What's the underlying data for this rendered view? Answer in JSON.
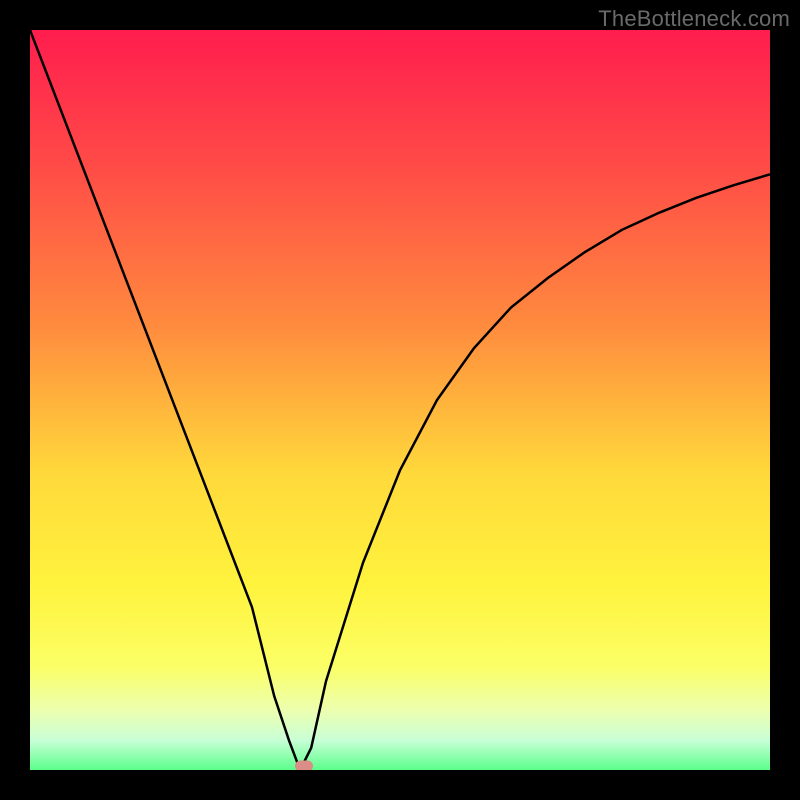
{
  "watermark": "TheBottleneck.com",
  "chart_data": {
    "type": "line",
    "title": "",
    "xlabel": "",
    "ylabel": "",
    "xlim": [
      0,
      100
    ],
    "ylim": [
      0,
      100
    ],
    "grid": false,
    "legend": false,
    "x": [
      0,
      5,
      10,
      15,
      20,
      25,
      30,
      33,
      35,
      36.5,
      38,
      40,
      45,
      50,
      55,
      60,
      65,
      70,
      75,
      80,
      85,
      90,
      95,
      100
    ],
    "values": [
      100,
      87,
      74,
      61,
      48,
      35,
      22,
      10,
      4,
      0,
      3,
      12,
      28,
      40.5,
      50,
      57,
      62.5,
      66.5,
      70,
      73,
      75.3,
      77.3,
      79,
      80.5
    ],
    "gradient_stops": [
      {
        "offset": 0,
        "color": "#ff1d4e"
      },
      {
        "offset": 0.18,
        "color": "#ff4a47"
      },
      {
        "offset": 0.4,
        "color": "#ff8b3e"
      },
      {
        "offset": 0.6,
        "color": "#ffd93b"
      },
      {
        "offset": 0.75,
        "color": "#fff33d"
      },
      {
        "offset": 0.86,
        "color": "#fbff66"
      },
      {
        "offset": 0.92,
        "color": "#ecffb0"
      },
      {
        "offset": 0.96,
        "color": "#c8ffd6"
      },
      {
        "offset": 1.0,
        "color": "#5bff8b"
      }
    ],
    "marker": {
      "x": 37,
      "y": 0,
      "color": "#db8d87"
    },
    "annotations": []
  }
}
